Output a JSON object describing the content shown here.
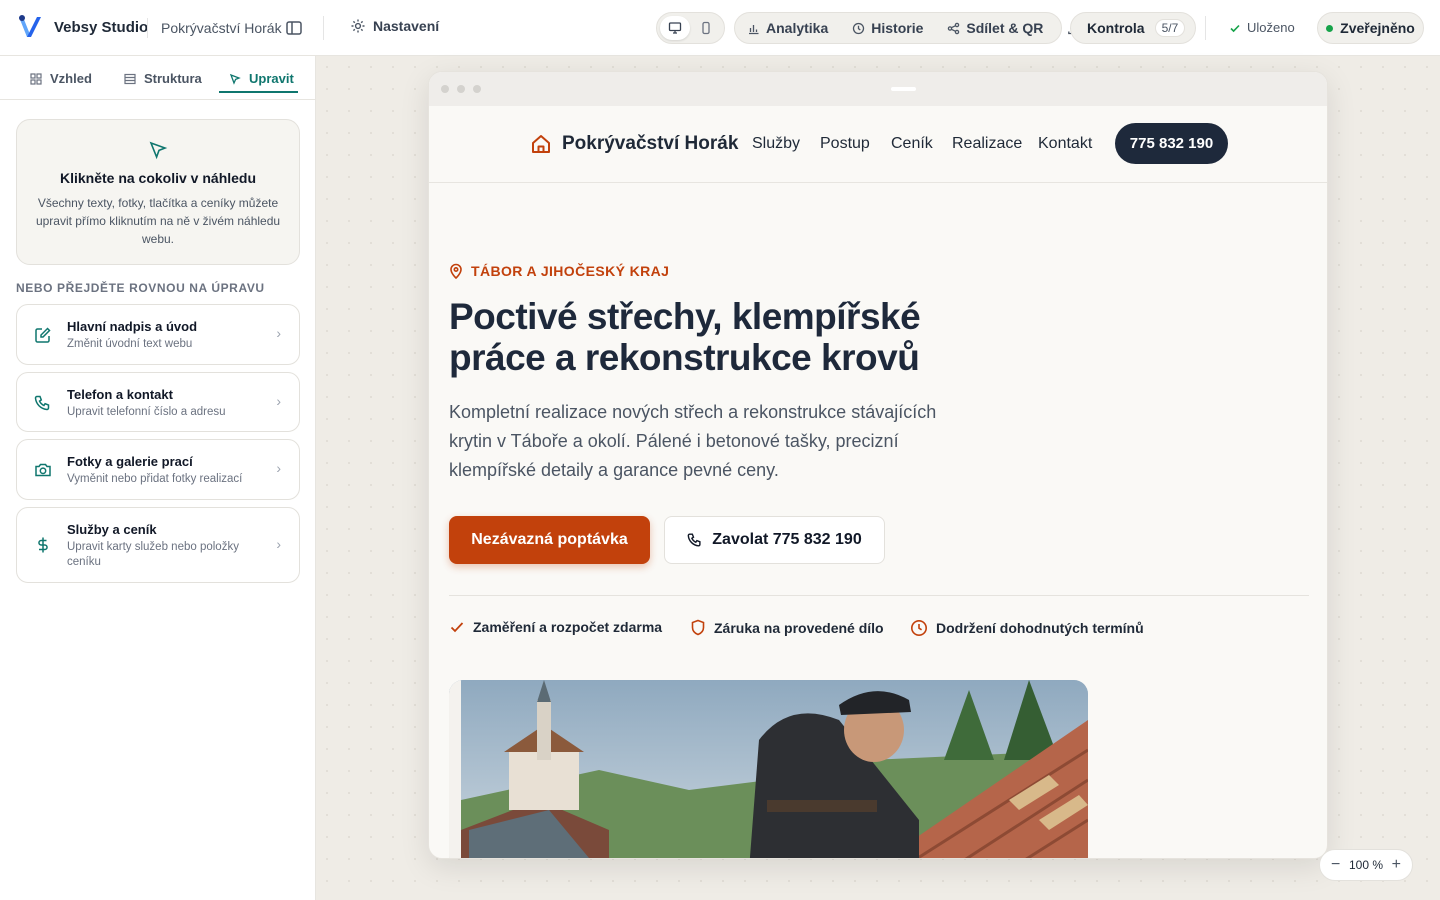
{
  "app": {
    "brand": "Vebsy Studio",
    "project_name": "Pokrývačství Horák",
    "settings_label": "Nastavení",
    "tools": {
      "analytics": "Analytika",
      "history": "Historie",
      "share": "Sdílet & QR"
    },
    "check": {
      "label": "Kontrola",
      "badge": "5/7"
    },
    "saved_label": "Uloženo",
    "published_label": "Zveřejněno",
    "zoom_label": "100 %"
  },
  "sidebar": {
    "tabs": [
      {
        "label": "Vzhled",
        "icon": "grid-icon"
      },
      {
        "label": "Struktura",
        "icon": "layout-icon"
      },
      {
        "label": "Upravit",
        "icon": "cursor-icon",
        "active": true
      }
    ],
    "hint": {
      "title": "Klikněte na cokoliv v náhledu",
      "text": "Všechny texty, fotky, tlačítka a ceníky můžete upravit přímo kliknutím na ně v živém náhledu webu."
    },
    "section_label": "NEBO PŘEJDĚTE ROVNOU NA ÚPRAVU",
    "cards": [
      {
        "title": "Hlavní nadpis a úvod",
        "subtitle": "Změnit úvodní text webu",
        "icon": "edit-icon"
      },
      {
        "title": "Telefon a kontakt",
        "subtitle": "Upravit telefonní číslo a adresu",
        "icon": "phone-icon"
      },
      {
        "title": "Fotky a galerie prací",
        "subtitle": "Vyměnit nebo přidat fotky realizací",
        "icon": "camera-icon"
      },
      {
        "title": "Služby a ceník",
        "subtitle": "Upravit karty služeb nebo položky ceníku",
        "icon": "dollar-icon"
      }
    ]
  },
  "site": {
    "name": "Pokrývačství Horák",
    "nav": [
      "Služby",
      "Postup",
      "Ceník",
      "Realizace",
      "Kontakt"
    ],
    "phone": "775 832 190",
    "location": "TÁBOR A JIHOČESKÝ KRAJ",
    "hero_title": "Poctivé střechy, klempířské práce a rekonstrukce krovů",
    "hero_lead": "Kompletní realizace nových střech a rekonstrukce stávajících krytin v Táboře a okolí. Pálené i betonové tašky, precizní klempířské detaily a garance pevné ceny.",
    "cta_primary": "Nezávazná poptávka",
    "cta_secondary": "Zavolat 775 832 190",
    "features": [
      {
        "label": "Zaměření a rozpočet zdarma",
        "icon": "check-icon"
      },
      {
        "label": "Záruka na provedené dílo",
        "icon": "shield-icon"
      },
      {
        "label": "Dodržení dohodnutých termínů",
        "icon": "clock-icon"
      }
    ]
  },
  "colors": {
    "accent": "#0f766e",
    "brand_orange": "#c2410c",
    "navy": "#1e293b"
  }
}
